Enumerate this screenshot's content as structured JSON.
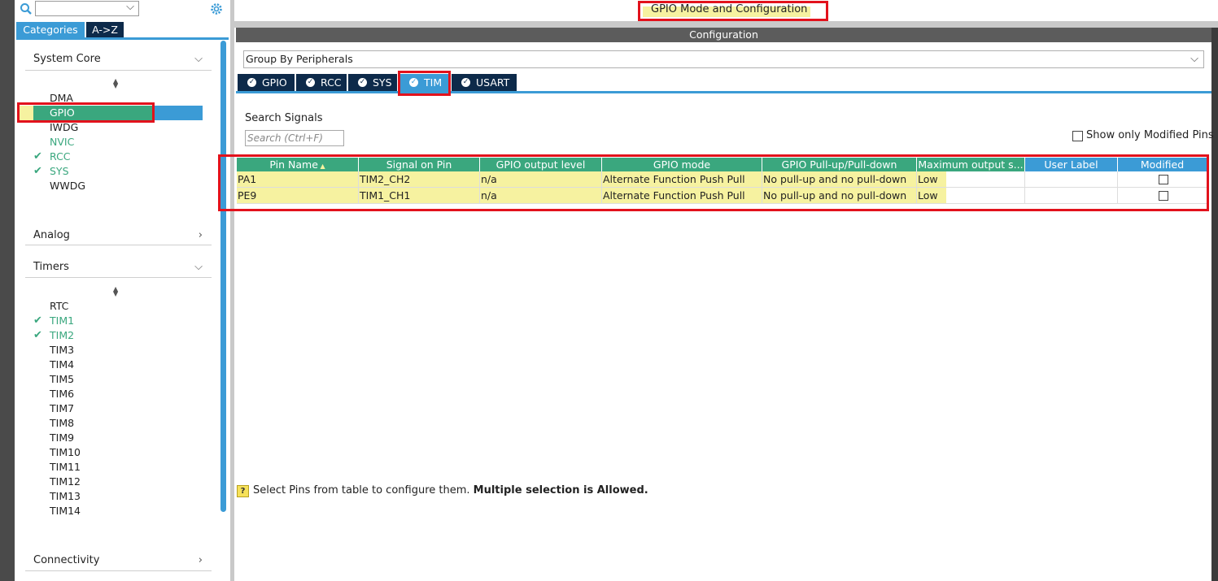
{
  "left_panel": {
    "tabs": [
      "Categories",
      "A->Z"
    ],
    "sections": {
      "system_core": {
        "title": "System Core",
        "items": [
          {
            "label": "DMA",
            "checked": false,
            "color": "normal"
          },
          {
            "label": "GPIO",
            "checked": false,
            "color": "selected"
          },
          {
            "label": "IWDG",
            "checked": false,
            "color": "normal"
          },
          {
            "label": "NVIC",
            "checked": false,
            "color": "green"
          },
          {
            "label": "RCC",
            "checked": true,
            "color": "green"
          },
          {
            "label": "SYS",
            "checked": true,
            "color": "green"
          },
          {
            "label": "WWDG",
            "checked": false,
            "color": "normal"
          }
        ]
      },
      "analog": {
        "title": "Analog"
      },
      "timers": {
        "title": "Timers",
        "items": [
          {
            "label": "RTC",
            "checked": false,
            "color": "normal"
          },
          {
            "label": "TIM1",
            "checked": true,
            "color": "green"
          },
          {
            "label": "TIM2",
            "checked": true,
            "color": "green"
          },
          {
            "label": "TIM3",
            "checked": false,
            "color": "normal"
          },
          {
            "label": "TIM4",
            "checked": false,
            "color": "normal"
          },
          {
            "label": "TIM5",
            "checked": false,
            "color": "normal"
          },
          {
            "label": "TIM6",
            "checked": false,
            "color": "normal"
          },
          {
            "label": "TIM7",
            "checked": false,
            "color": "normal"
          },
          {
            "label": "TIM8",
            "checked": false,
            "color": "normal"
          },
          {
            "label": "TIM9",
            "checked": false,
            "color": "normal"
          },
          {
            "label": "TIM10",
            "checked": false,
            "color": "normal"
          },
          {
            "label": "TIM11",
            "checked": false,
            "color": "normal"
          },
          {
            "label": "TIM12",
            "checked": false,
            "color": "normal"
          },
          {
            "label": "TIM13",
            "checked": false,
            "color": "normal"
          },
          {
            "label": "TIM14",
            "checked": false,
            "color": "normal"
          }
        ]
      },
      "connectivity": {
        "title": "Connectivity"
      }
    }
  },
  "main": {
    "title": "GPIO Mode and Configuration",
    "config_bar": "Configuration",
    "group_by": "Group By Peripherals",
    "peripheral_tabs": [
      "GPIO",
      "RCC",
      "SYS",
      "TIM",
      "USART"
    ],
    "active_tab": "TIM",
    "search_label": "Search Signals",
    "search_placeholder": "Search (Ctrl+F)",
    "show_modified_label": "Show only Modified Pins",
    "table": {
      "columns": [
        "Pin Name",
        "Signal on Pin",
        "GPIO output level",
        "GPIO mode",
        "GPIO Pull-up/Pull-down",
        "Maximum output s...",
        "User Label",
        "Modified"
      ],
      "rows": [
        [
          "PA1",
          "TIM2_CH2",
          "n/a",
          "Alternate Function Push Pull",
          "No pull-up and no pull-down",
          "Low",
          "",
          ""
        ],
        [
          "PE9",
          "TIM1_CH1",
          "n/a",
          "Alternate Function Push Pull",
          "No pull-up and no pull-down",
          "Low",
          "",
          ""
        ]
      ]
    },
    "hint_normal": "Select Pins from table to configure them.",
    "hint_bold": "Multiple selection is Allowed."
  },
  "colors": {
    "accent_blue": "#3b9bd6",
    "accent_green": "#3aa77e",
    "navy": "#0d2a4a",
    "highlight_yellow": "#f6f2a0",
    "annotation_red": "#e2121c"
  }
}
